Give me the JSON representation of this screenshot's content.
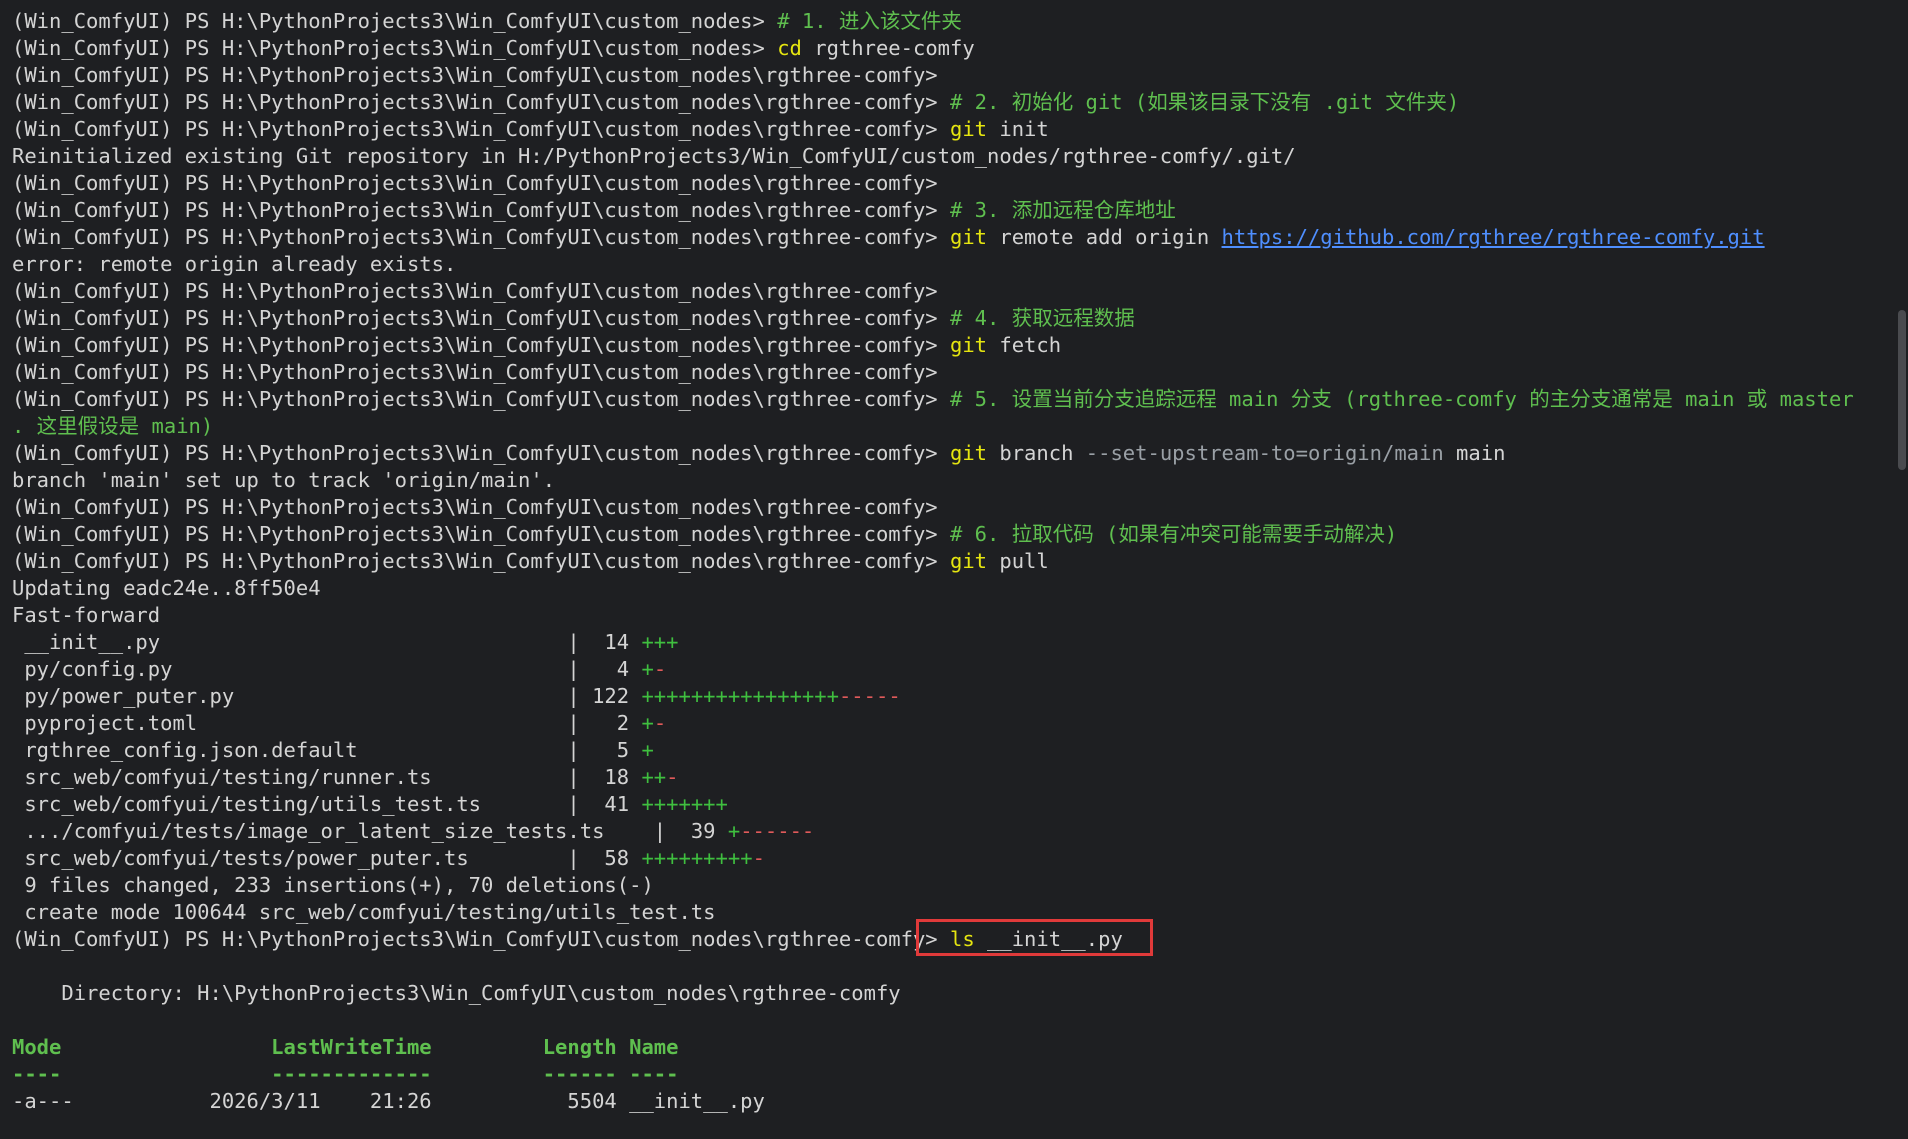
{
  "prompt": "(Win_ComfyUI) PS H:\\PythonProjects3\\Win_ComfyUI\\custom_nodes> ",
  "prompt_rg": "(Win_ComfyUI) PS H:\\PythonProjects3\\Win_ComfyUI\\custom_nodes\\rgthree-comfy> ",
  "lines": {
    "l0_comment": "# 1. 进入该文件夹",
    "l1_cmd": "cd",
    "l1_arg": " rgthree-comfy",
    "l3_comment": "# 2. 初始化 git (如果该目录下没有 .git 文件夹)",
    "l4_cmd": "git",
    "l4_arg": " init",
    "l5_out": "Reinitialized existing Git repository in H:/PythonProjects3/Win_ComfyUI/custom_nodes/rgthree-comfy/.git/",
    "l7_comment": "# 3. 添加远程仓库地址",
    "l8_cmd": "git",
    "l8_arg": " remote add origin ",
    "l8_link": "https://github.com/rgthree/rgthree-comfy.git",
    "l9_out": "error: remote origin already exists.",
    "l11_comment": "# 4. 获取远程数据",
    "l12_cmd": "git",
    "l12_arg": " fetch",
    "l14_comment": "# 5. 设置当前分支追踪远程 main 分支 (rgthree-comfy 的主分支通常是 main 或 master",
    "l15_comment": ". 这里假设是 main)",
    "l16_cmd": "git",
    "l16_arg": " branch ",
    "l16_param": "--set-upstream-to=origin/main",
    "l16_arg2": " main",
    "l17_out": "branch 'main' set up to track 'origin/main'.",
    "l19_comment": "# 6. 拉取代码 (如果有冲突可能需要手动解决)",
    "l20_cmd": "git",
    "l20_arg": " pull",
    "l21_out": "Updating eadc24e..8ff50e4",
    "l22_out": "Fast-forward",
    "summary": " 9 files changed, 233 insertions(+), 70 deletions(-)",
    "create_mode": " create mode 100644 src_web/comfyui/testing/utils_test.ts",
    "ls_cmd": "ls",
    "ls_arg": " __init__.py",
    "directory": "    Directory: H:\\PythonProjects3\\Win_ComfyUI\\custom_nodes\\rgthree-comfy"
  },
  "diffstat": [
    {
      "file": " __init__.py                                 ",
      "count": "|  14 ",
      "plus": "+++",
      "minus": ""
    },
    {
      "file": " py/config.py                                ",
      "count": "|   4 ",
      "plus": "+",
      "minus": "-"
    },
    {
      "file": " py/power_puter.py                           ",
      "count": "| 122 ",
      "plus": "++++++++++++++++",
      "minus": "-----"
    },
    {
      "file": " pyproject.toml                              ",
      "count": "|   2 ",
      "plus": "+",
      "minus": "-"
    },
    {
      "file": " rgthree_config.json.default                 ",
      "count": "|   5 ",
      "plus": "+",
      "minus": ""
    },
    {
      "file": " src_web/comfyui/testing/runner.ts           ",
      "count": "|  18 ",
      "plus": "++",
      "minus": "-"
    },
    {
      "file": " src_web/comfyui/testing/utils_test.ts       ",
      "count": "|  41 ",
      "plus": "+++++++",
      "minus": ""
    },
    {
      "file": " .../comfyui/tests/image_or_latent_size_tests.ts    ",
      "count": "|  39 ",
      "plus": "+",
      "minus": "------"
    },
    {
      "file": " src_web/comfyui/tests/power_puter.ts        ",
      "count": "|  58 ",
      "plus": "+++++++++",
      "minus": "-"
    }
  ],
  "listing": {
    "header": "Mode                 LastWriteTime         Length Name",
    "underline": "----                 -------------         ------ ----",
    "row": "-a---           2026/3/11    21:26           5504 __init__.py"
  },
  "colors": {
    "background": "#1e1f22",
    "command": "#e5e510",
    "comment": "#5fbf4f",
    "link": "#4f8fff",
    "highlight": "#e03a3a"
  }
}
